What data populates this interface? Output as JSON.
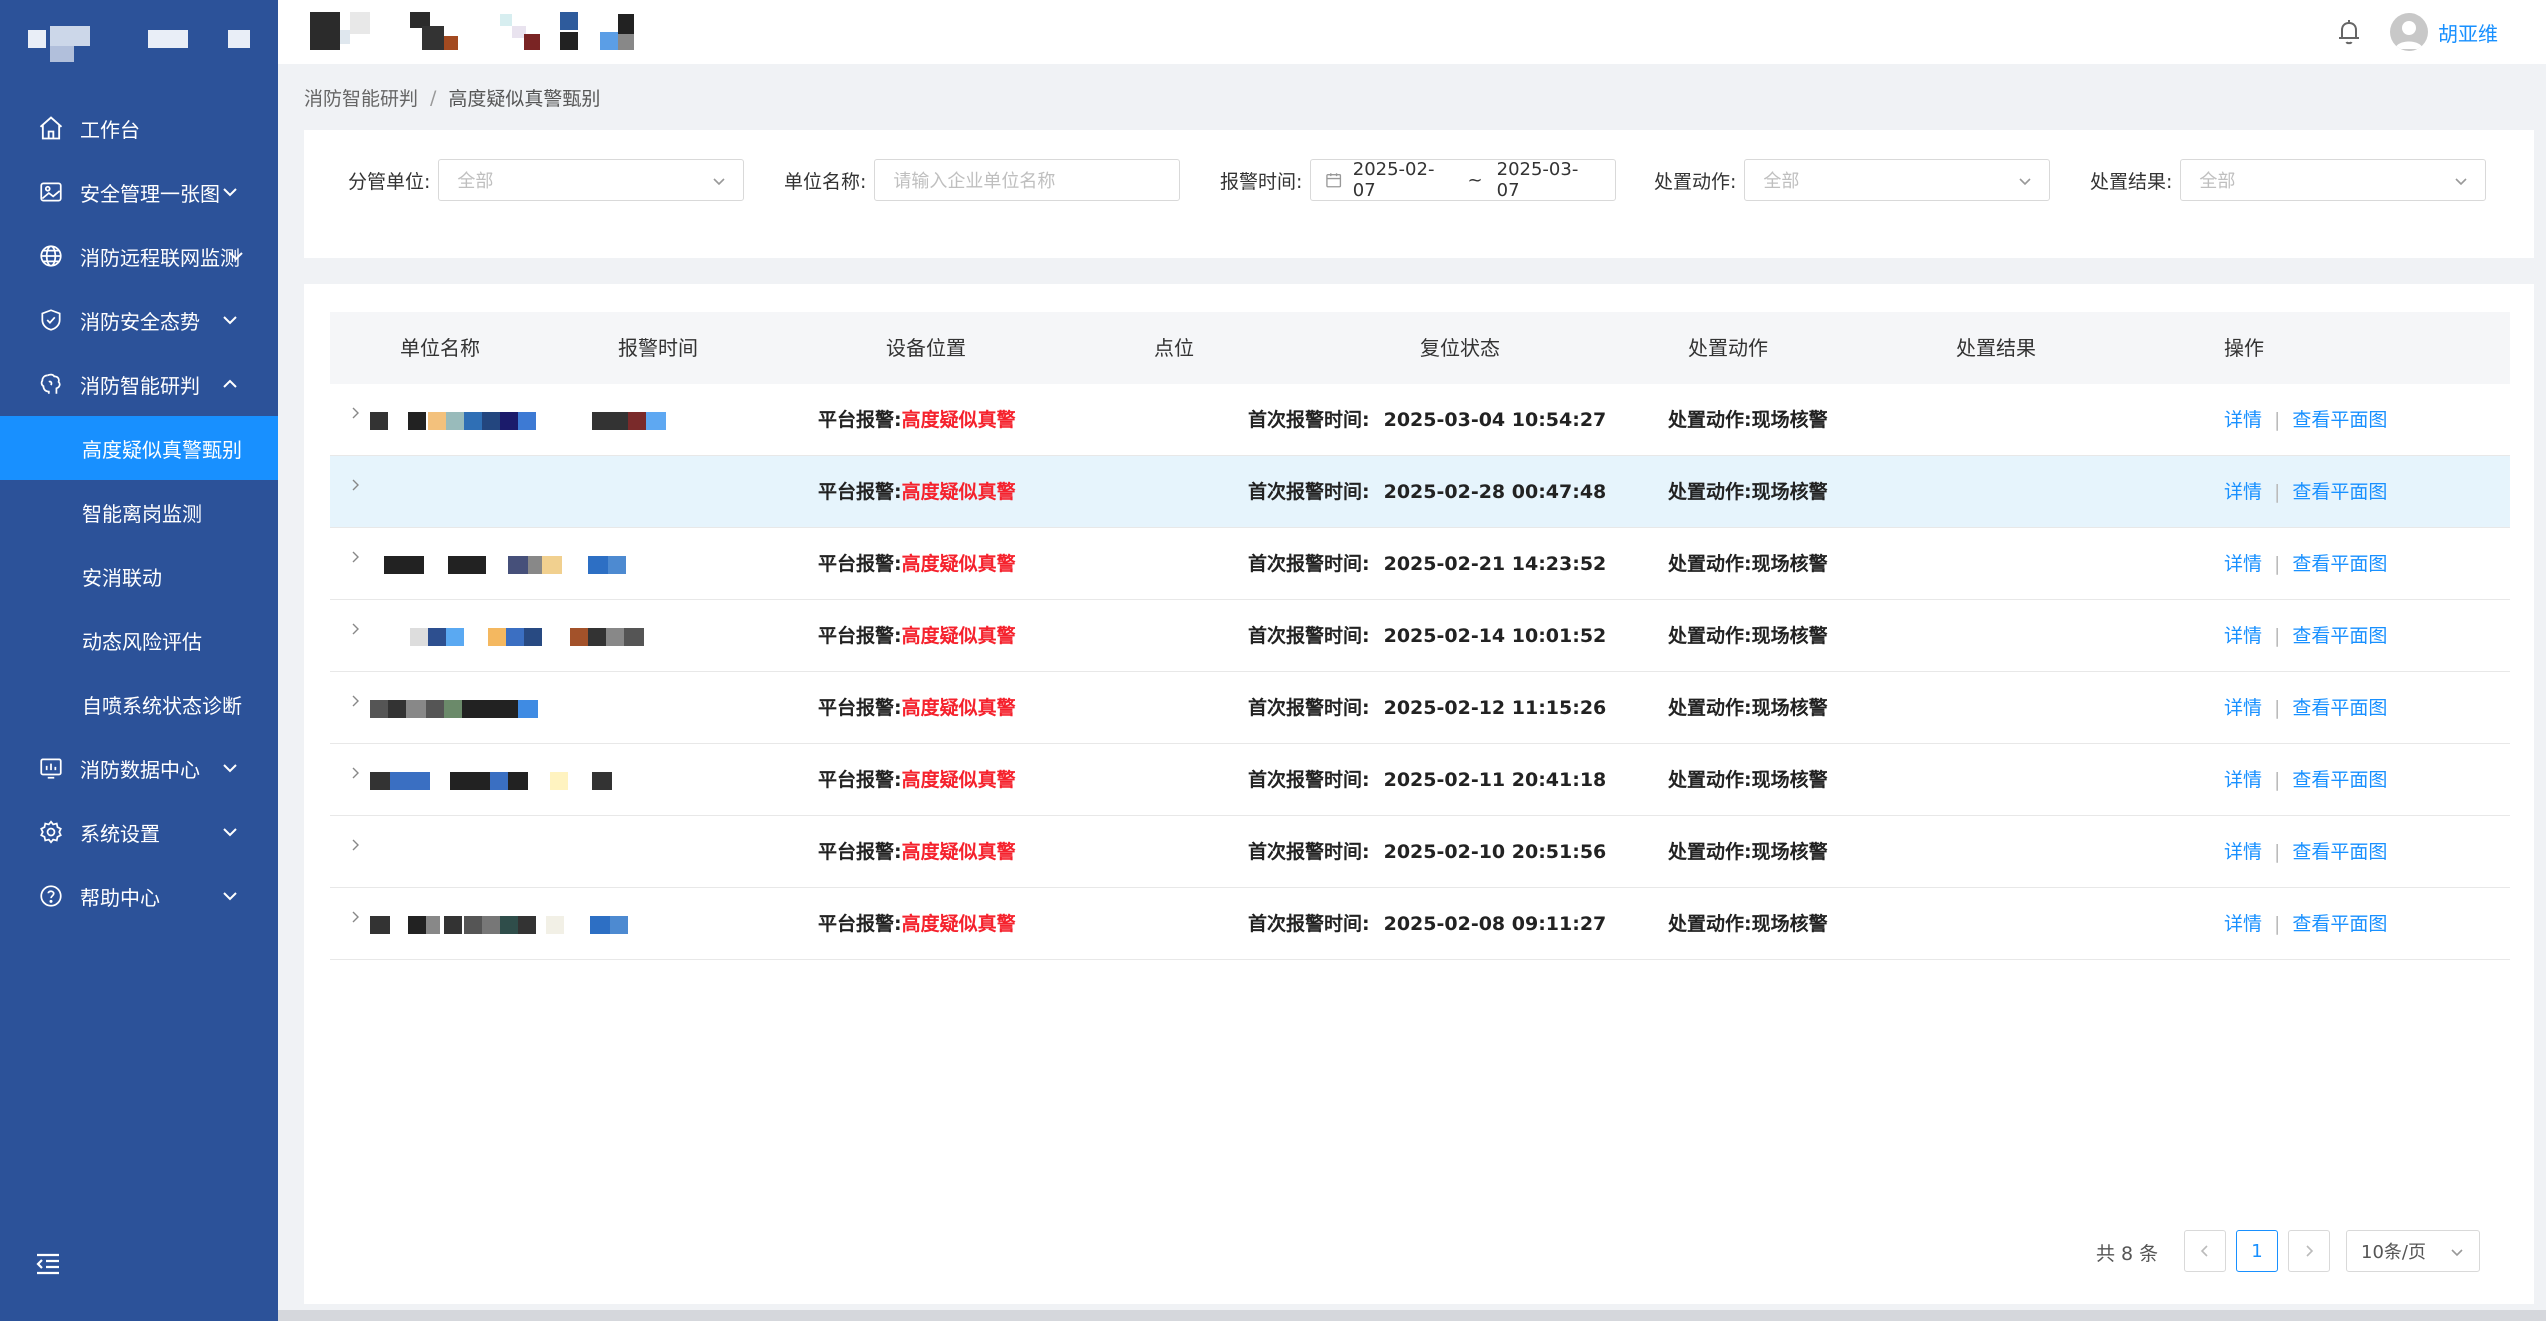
{
  "colors": {
    "sidebar_bg": "#2c5299",
    "sidebar_active": "#1890ff",
    "link": "#1890ff",
    "alert_red": "#f5222d",
    "hover_row": "#e6f4fc"
  },
  "header": {
    "username": "胡亚维"
  },
  "sidebar": {
    "items": [
      {
        "label": "工作台",
        "icon": "home-icon",
        "arrow": ""
      },
      {
        "label": "安全管理一张图",
        "icon": "image-icon",
        "arrow": "down"
      },
      {
        "label": "消防远程联网监测",
        "icon": "globe-icon",
        "arrow": "down"
      },
      {
        "label": "消防安全态势",
        "icon": "shield-icon",
        "arrow": "down"
      },
      {
        "label": "消防智能研判",
        "icon": "brain-icon",
        "arrow": "up"
      }
    ],
    "subitems": [
      {
        "label": "高度疑似真警甄别",
        "active": true
      },
      {
        "label": "智能离岗监测",
        "active": false
      },
      {
        "label": "安消联动",
        "active": false
      },
      {
        "label": "动态风险评估",
        "active": false
      },
      {
        "label": "自喷系统状态诊断",
        "active": false
      }
    ],
    "items_after": [
      {
        "label": "消防数据中心",
        "icon": "data-icon",
        "arrow": "down"
      },
      {
        "label": "系统设置",
        "icon": "gear-icon",
        "arrow": "down"
      },
      {
        "label": "帮助中心",
        "icon": "help-icon",
        "arrow": "down"
      }
    ]
  },
  "breadcrumb": {
    "parent": "消防智能研判",
    "separator": "/",
    "current": "高度疑似真警甄别"
  },
  "filters": {
    "division": {
      "label": "分管单位:",
      "value": "全部"
    },
    "unit_name": {
      "label": "单位名称:",
      "placeholder": "请输入企业单位名称"
    },
    "alarm_time": {
      "label": "报警时间:",
      "start": "2025-02-07",
      "separator": "~",
      "end": "2025-03-07"
    },
    "action": {
      "label": "处置动作:",
      "value": "全部"
    },
    "result": {
      "label": "处置结果:",
      "value": "全部"
    }
  },
  "table": {
    "headers": [
      "单位名称",
      "报警时间",
      "设备位置",
      "点位",
      "复位状态",
      "处置动作",
      "处置结果",
      "操作"
    ],
    "rows": [
      {
        "alarm_label": "平台报警:",
        "alarm_type": "高度疑似真警",
        "first_label": "首次报警时间:",
        "first_time": "2025-03-04 10:54:27",
        "action_label": "处置动作:",
        "action": "现场核警",
        "op_detail": "详情",
        "op_sep": "|",
        "op_plan": "查看平面图"
      },
      {
        "alarm_label": "平台报警:",
        "alarm_type": "高度疑似真警",
        "first_label": "首次报警时间:",
        "first_time": "2025-02-28 00:47:48",
        "action_label": "处置动作:",
        "action": "现场核警",
        "op_detail": "详情",
        "op_sep": "|",
        "op_plan": "查看平面图"
      },
      {
        "alarm_label": "平台报警:",
        "alarm_type": "高度疑似真警",
        "first_label": "首次报警时间:",
        "first_time": "2025-02-21 14:23:52",
        "action_label": "处置动作:",
        "action": "现场核警",
        "op_detail": "详情",
        "op_sep": "|",
        "op_plan": "查看平面图"
      },
      {
        "alarm_label": "平台报警:",
        "alarm_type": "高度疑似真警",
        "first_label": "首次报警时间:",
        "first_time": "2025-02-14 10:01:52",
        "action_label": "处置动作:",
        "action": "现场核警",
        "op_detail": "详情",
        "op_sep": "|",
        "op_plan": "查看平面图"
      },
      {
        "alarm_label": "平台报警:",
        "alarm_type": "高度疑似真警",
        "first_label": "首次报警时间:",
        "first_time": "2025-02-12 11:15:26",
        "action_label": "处置动作:",
        "action": "现场核警",
        "op_detail": "详情",
        "op_sep": "|",
        "op_plan": "查看平面图"
      },
      {
        "alarm_label": "平台报警:",
        "alarm_type": "高度疑似真警",
        "first_label": "首次报警时间:",
        "first_time": "2025-02-11 20:41:18",
        "action_label": "处置动作:",
        "action": "现场核警",
        "op_detail": "详情",
        "op_sep": "|",
        "op_plan": "查看平面图"
      },
      {
        "alarm_label": "平台报警:",
        "alarm_type": "高度疑似真警",
        "first_label": "首次报警时间:",
        "first_time": "2025-02-10 20:51:56",
        "action_label": "处置动作:",
        "action": "现场核警",
        "op_detail": "详情",
        "op_sep": "|",
        "op_plan": "查看平面图"
      },
      {
        "alarm_label": "平台报警:",
        "alarm_type": "高度疑似真警",
        "first_label": "首次报警时间:",
        "first_time": "2025-02-08 09:11:27",
        "action_label": "处置动作:",
        "action": "现场核警",
        "op_detail": "详情",
        "op_sep": "|",
        "op_plan": "查看平面图"
      }
    ]
  },
  "pagination": {
    "total_text": "共 8 条",
    "current_page": "1",
    "page_size": "10条/页"
  }
}
